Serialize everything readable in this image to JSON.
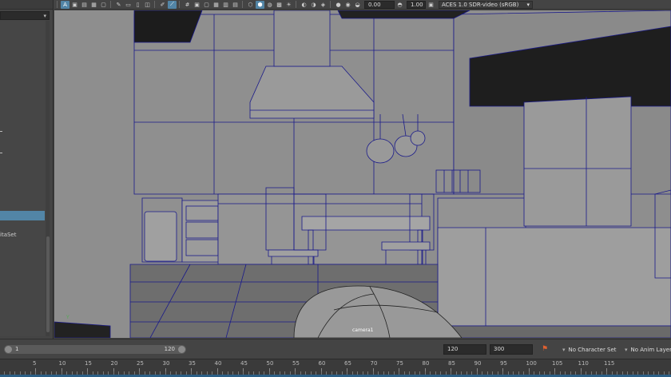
{
  "outliner": {
    "dataset_label": "itaSet"
  },
  "toolbar": {
    "exposure_value": "0.00",
    "gamma_value": "1.00",
    "color_space": "ACES 1.0 SDR-video (sRGB)"
  },
  "viewport": {
    "camera_name": "camera1",
    "axis_label": "Y"
  },
  "range_bar": {
    "range_start": "1",
    "range_end": "120",
    "playback_end": "120",
    "animation_end": "300",
    "character_set": "No Character Set",
    "anim_layer": "No Anim Layer"
  },
  "timeline": {
    "ticks": [
      "5",
      "10",
      "15",
      "20",
      "25",
      "30",
      "35",
      "40",
      "45",
      "50",
      "55",
      "60",
      "65",
      "70",
      "75",
      "80",
      "85",
      "90",
      "95",
      "100",
      "105",
      "110",
      "115"
    ]
  },
  "colors": {
    "accent": "#5285a6",
    "wireframe": "#1a1a8a",
    "viewport_bg": "#8e8e8e",
    "key_icon": "#e06030"
  }
}
